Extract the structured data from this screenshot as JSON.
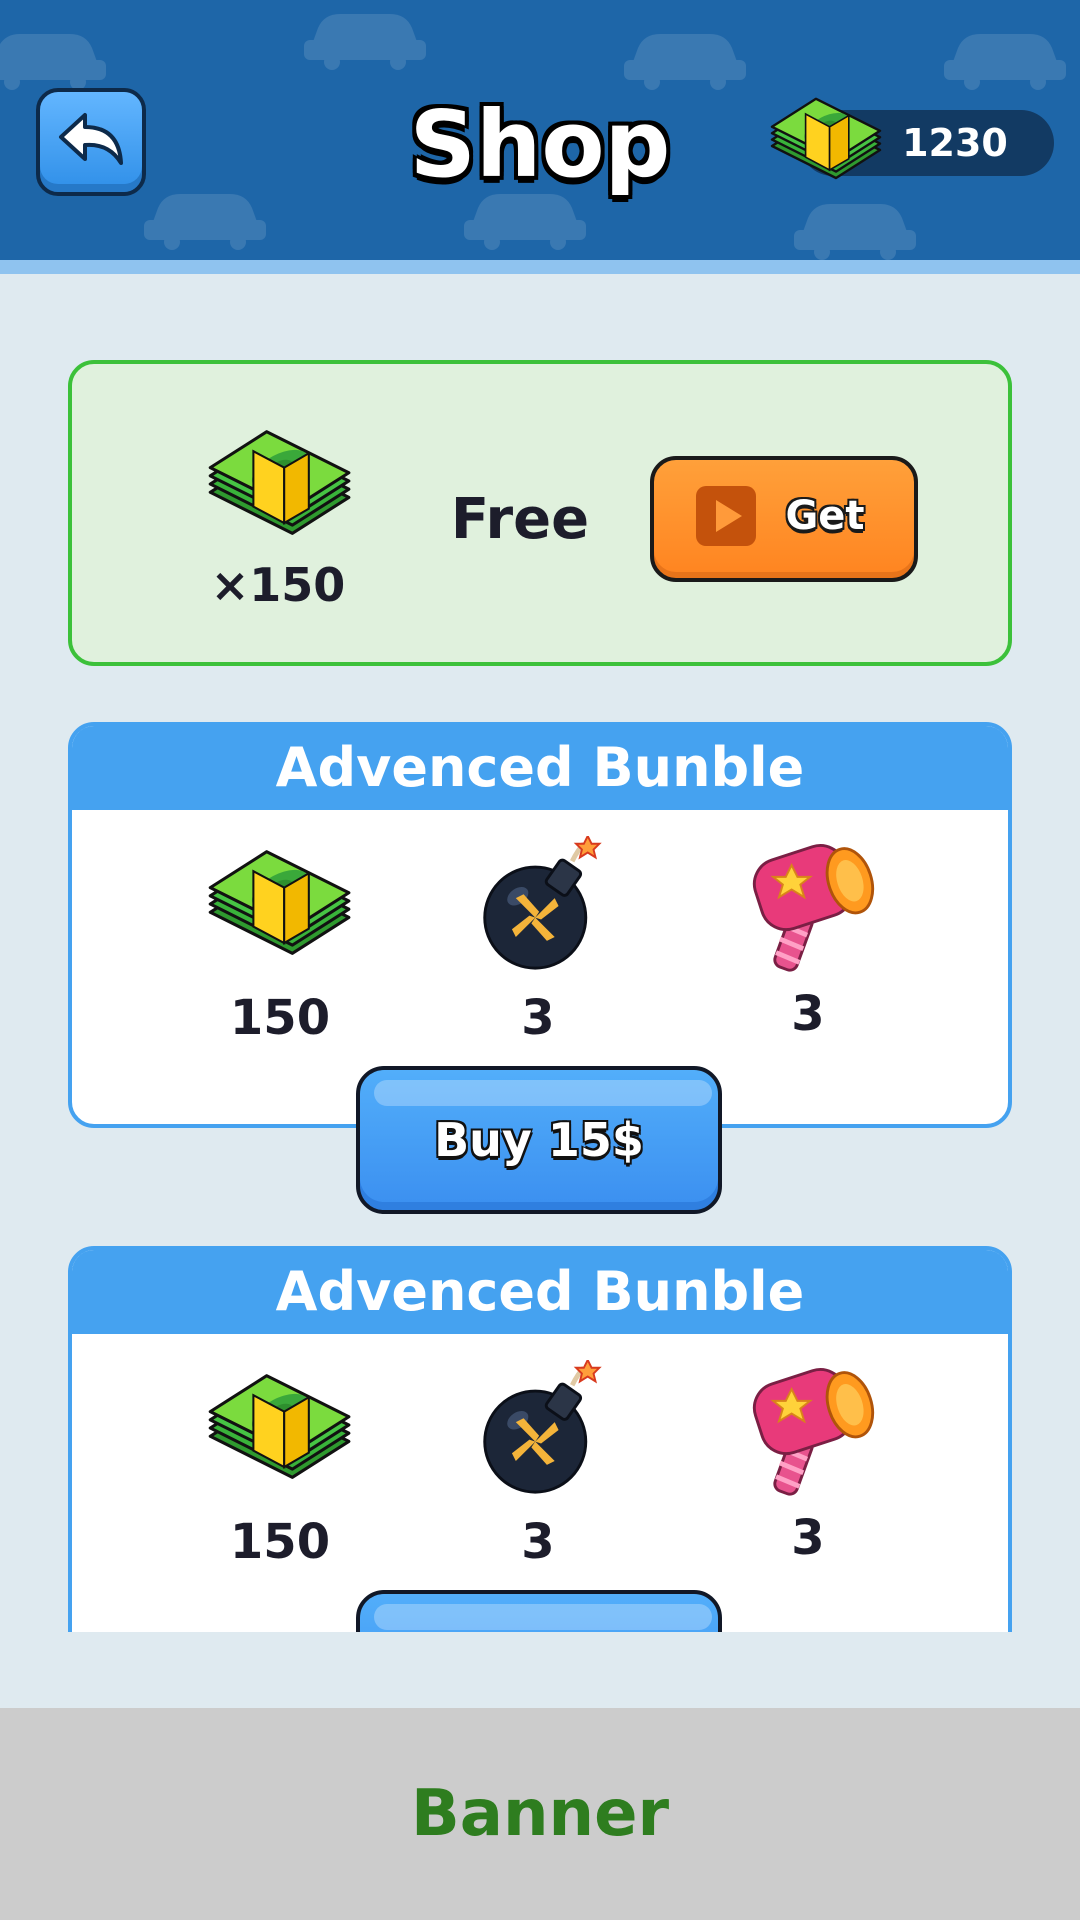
{
  "header": {
    "title": "Shop",
    "currency_amount": "1230",
    "back_icon": "back-arrow-icon",
    "currency_icon": "cash-stack-icon"
  },
  "free_offer": {
    "amount": "×150",
    "label": "Free",
    "button_label": "Get",
    "button_icon": "play-video-icon"
  },
  "bundles": [
    {
      "title": "Advenced Bunble",
      "items": [
        {
          "icon": "cash-stack-icon",
          "count": "150"
        },
        {
          "icon": "bomb-icon",
          "count": "3"
        },
        {
          "icon": "hammer-icon",
          "count": "3"
        }
      ],
      "buy_label": "Buy 15$"
    },
    {
      "title": "Advenced Bunble",
      "items": [
        {
          "icon": "cash-stack-icon",
          "count": "150"
        },
        {
          "icon": "bomb-icon",
          "count": "3"
        },
        {
          "icon": "hammer-icon",
          "count": "3"
        }
      ],
      "buy_label": ""
    }
  ],
  "banner": {
    "label": "Banner"
  },
  "colors": {
    "header_bg": "#1e66a8",
    "page_bg": "#dfeaf0",
    "free_card_bg": "#e0f1dd",
    "free_card_border": "#3cc13a",
    "bundle_accent": "#45a2f0",
    "get_button": "#ff8c26",
    "buy_button": "#45a2f0",
    "banner_bg": "#cccccc",
    "banner_text": "#2e7d1f"
  }
}
